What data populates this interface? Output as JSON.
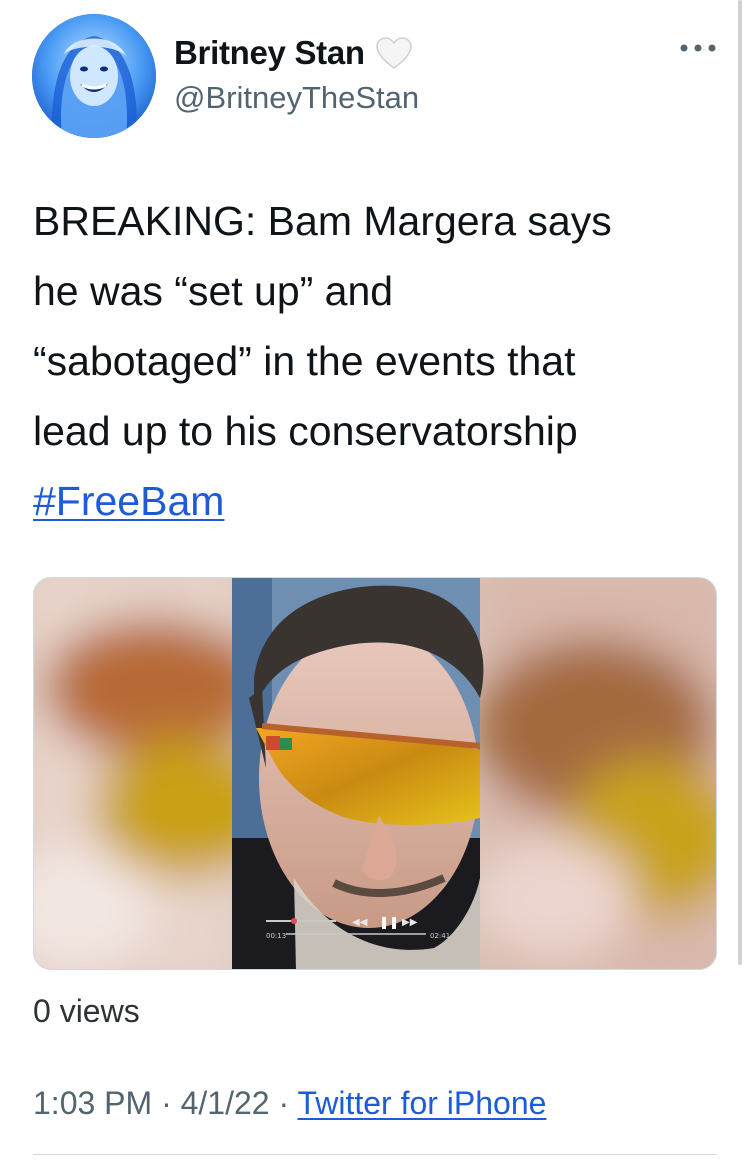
{
  "author": {
    "display_name": "Britney Stan",
    "handle": "@BritneyTheStan",
    "avatar_icon": "avatar-photo",
    "badge_icon": "white-heart-icon"
  },
  "more_icon": "more-horizontal-icon",
  "tweet": {
    "text_lines": [
      "BREAKING: Bam Margera says",
      "he was “set up” and",
      "“sabotaged” in the events that",
      "lead up to his conservatorship"
    ],
    "hashtag": "#FreeBam"
  },
  "media": {
    "type": "video",
    "player": {
      "time_elapsed": "00:13",
      "time_total": "02:41"
    }
  },
  "stats": {
    "views": "0 views"
  },
  "meta": {
    "time": "1:03 PM",
    "separator": "·",
    "date": "4/1/22",
    "source": "Twitter for iPhone"
  },
  "colors": {
    "link": "#1d5bd8",
    "secondary_text": "#536471",
    "divider": "#cfd9de"
  }
}
